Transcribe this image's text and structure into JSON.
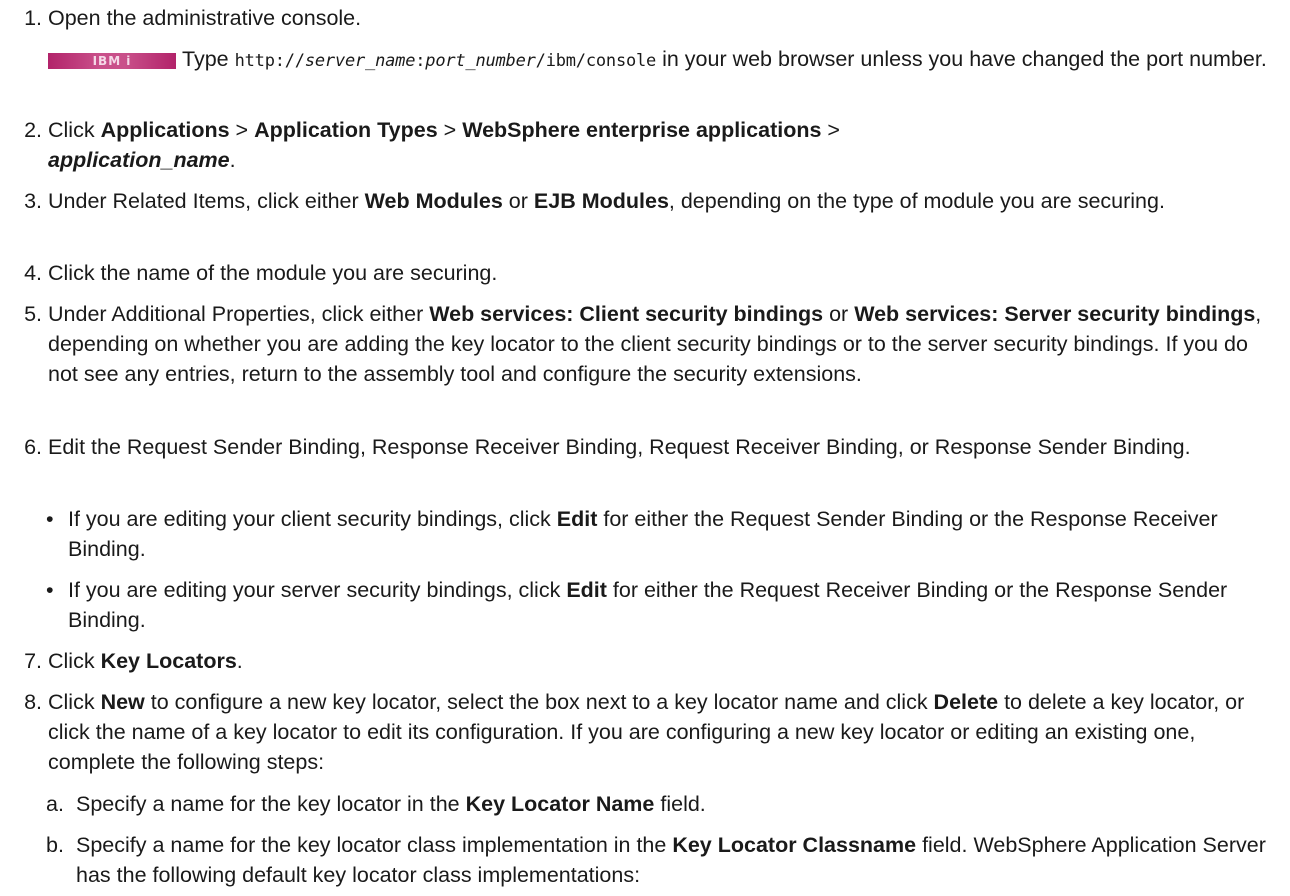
{
  "steps": {
    "s1": {
      "num": "1.",
      "text": "Open the administrative console."
    },
    "s1note": {
      "badge": "IBM i",
      "pre": "Type ",
      "url_a": "http://",
      "url_b": "server_name",
      "url_c": ":",
      "url_d": "port_number",
      "url_e": "/ibm/console",
      "post": " in your web browser unless you have changed the port number."
    },
    "s2": {
      "num": "2.",
      "a": "Click ",
      "b": "Applications",
      "c": " > ",
      "d": "Application Types",
      "e": " > ",
      "f": "WebSphere enterprise applications",
      "g": " > ",
      "h": "application_name",
      "i": "."
    },
    "s3": {
      "num": "3.",
      "a": "Under Related Items, click either ",
      "b": "Web Modules",
      "c": " or ",
      "d": "EJB Modules",
      "e": ", depending on the type of module you are securing."
    },
    "s4": {
      "num": "4.",
      "text": "Click the name of the module you are securing."
    },
    "s5": {
      "num": "5.",
      "a": "Under Additional Properties, click either ",
      "b": "Web services: Client security bindings",
      "c": " or ",
      "d": "Web services: Server security bindings",
      "e": ", depending on whether you are adding the key locator to the client security bindings or to the server security bindings. If you do not see any entries, return to the assembly tool and configure the security extensions."
    },
    "s6": {
      "num": "6.",
      "text": "Edit the Request Sender Binding, Response Receiver Binding, Request Receiver Binding, or Response Sender Binding.",
      "bullet1": {
        "dot": "•",
        "a": "If you are editing your client security bindings, click ",
        "b": "Edit",
        "c": " for either the Request Sender Binding or the Response Receiver Binding."
      },
      "bullet2": {
        "dot": "•",
        "a": "If you are editing your server security bindings, click ",
        "b": "Edit",
        "c": " for either the Request Receiver Binding or the Response Sender Binding."
      }
    },
    "s7": {
      "num": "7.",
      "a": "Click ",
      "b": "Key Locators",
      "c": "."
    },
    "s8": {
      "num": "8.",
      "a": "Click ",
      "b": "New",
      "c": " to configure a new key locator, select the box next to a key locator name and click ",
      "d": "Delete",
      "e": " to delete a key locator, or click the name of a key locator to edit its configuration. If you are configuring a new key locator or editing an existing one, complete the following steps:",
      "suba": {
        "letter": "a.",
        "a": "Specify a name for the key locator in the ",
        "b": "Key Locator Name",
        "c": " field."
      },
      "subb": {
        "letter": "b.",
        "a": "Specify a name for the key locator class implementation in the ",
        "b": "Key Locator Classname",
        "c": " field. WebSphere Application Server has the following default key locator class implementations:"
      }
    }
  }
}
